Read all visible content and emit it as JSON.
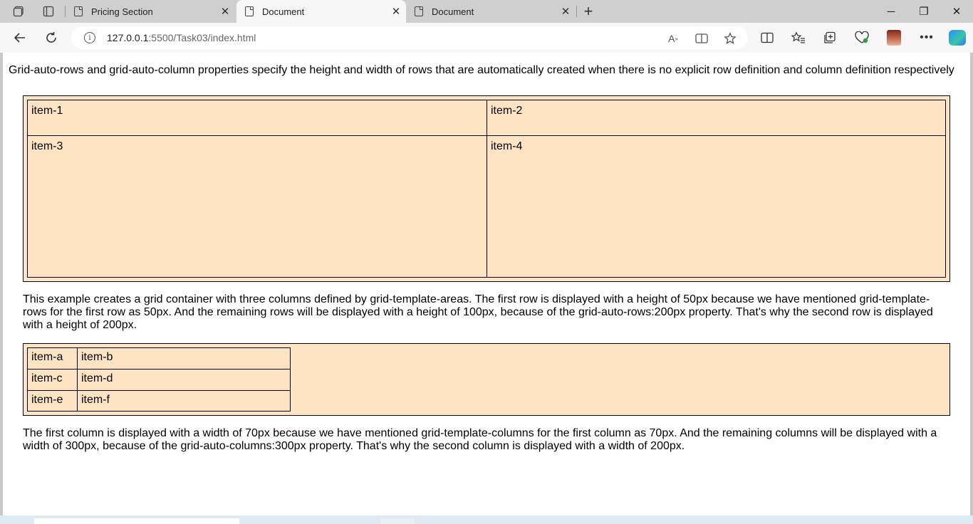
{
  "browser": {
    "tabs": [
      {
        "title": "Pricing Section",
        "active": false
      },
      {
        "title": "Document",
        "active": true
      },
      {
        "title": "Document",
        "active": false
      }
    ],
    "new_tab_glyph": "+",
    "close_glyph": "✕",
    "url_host": "127.0.0.1",
    "url_rest": ":5500/Task03/index.html",
    "window": {
      "minimize": "─",
      "restore": "❐",
      "close": "✕"
    },
    "icons": [
      "workspaces-icon",
      "tab-actions-icon",
      "back-icon",
      "refresh-icon",
      "info-icon",
      "read-aloud-icon",
      "immersive-reader-icon",
      "favorite-star-icon",
      "split-screen-icon",
      "favorites-icon",
      "collections-icon",
      "browser-essentials-icon",
      "profile-avatar",
      "more-icon",
      "copilot-icon"
    ]
  },
  "page": {
    "intro": "Grid-auto-rows and grid-auto-column properties specify the height and width of rows that are automatically created when there is no explicit row definition and column definition respectively",
    "grid1": {
      "background": "#ffe4c4",
      "items": [
        "item-1",
        "item-2",
        "item-3",
        "item-4"
      ]
    },
    "para1": "This example creates a grid container with three columns defined by grid-template-areas. The first row is displayed with a height of 50px because we have mentioned grid-template-rows for the first row as 50px. And the remaining rows will be displayed with a height of 100px, because of the grid-auto-rows:200px property. That's why the second row is displayed with a height of 200px.",
    "grid2": {
      "background": "#ffe4c4",
      "items": [
        "item-a",
        "item-b",
        "item-c",
        "item-d",
        "item-e",
        "item-f"
      ]
    },
    "para2": "The first column is displayed with a width of 70px because we have mentioned grid-template-columns for the first column as 70px. And the remaining columns will be displayed with a width of 300px, because of the grid-auto-columns:300px property. That's why the second column is displayed with a width of 200px."
  }
}
